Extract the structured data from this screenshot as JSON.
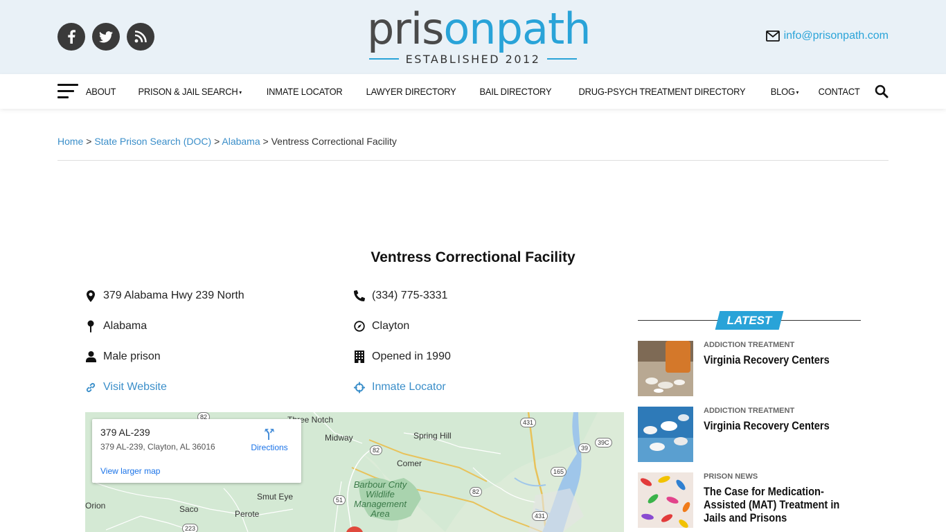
{
  "header": {
    "social": [
      "facebook-icon",
      "twitter-icon",
      "rss-icon"
    ],
    "logo": {
      "part1": "pris",
      "part2": "on",
      "part3": "path",
      "tagline": "ESTABLISHED 2012"
    },
    "email": "info@prisonpath.com"
  },
  "nav": {
    "items": [
      {
        "label": "ABOUT",
        "has_dropdown": false
      },
      {
        "label": "PRISON & JAIL SEARCH",
        "has_dropdown": true
      },
      {
        "label": "INMATE LOCATOR",
        "has_dropdown": false
      },
      {
        "label": "LAWYER DIRECTORY",
        "has_dropdown": false
      },
      {
        "label": "BAIL DIRECTORY",
        "has_dropdown": false
      },
      {
        "label": "DRUG-PSYCH TREATMENT DIRECTORY",
        "has_dropdown": false
      },
      {
        "label": "BLOG",
        "has_dropdown": true
      },
      {
        "label": "CONTACT",
        "has_dropdown": false
      }
    ]
  },
  "breadcrumb": {
    "home": "Home",
    "sep": ">",
    "state_search": "State Prison Search (DOC)",
    "state": "Alabama",
    "current": "Ventress Correctional Facility"
  },
  "facility": {
    "title": "Ventress Correctional Facility",
    "address": "379 Alabama Hwy 239 North",
    "phone": "(334) 775-3331",
    "state": "Alabama",
    "city": "Clayton",
    "type": "Male prison",
    "opened": "Opened in 1990",
    "website_link": "Visit Website",
    "inmate_locator_link": "Inmate Locator"
  },
  "map": {
    "card_title": "379 AL-239",
    "card_address": "379 AL-239, Clayton, AL 36016",
    "directions": "Directions",
    "larger_map": "View larger map",
    "places": [
      "Three Notch",
      "Midway",
      "Spring Hill",
      "Comer",
      "Smut Eye",
      "Orion",
      "Saco",
      "Perote"
    ],
    "park": "Barbour Cnty Wildlife Management Area",
    "roads": [
      "82",
      "431",
      "39C",
      "39",
      "165",
      "51",
      "223"
    ]
  },
  "sidebar": {
    "latest_label": "LATEST",
    "posts": [
      {
        "category": "ADDICTION TREATMENT",
        "title": "Virginia Recovery Centers"
      },
      {
        "category": "ADDICTION TREATMENT",
        "title": "Virginia Recovery Centers"
      },
      {
        "category": "PRISON NEWS",
        "title": "The Case for Medication-Assisted (MAT) Treatment in Jails and Prisons"
      }
    ]
  },
  "colors": {
    "accent": "#29a3d8",
    "link": "#3a8ec9",
    "header_bg": "#e9f1f7",
    "dark": "#3a3a3a"
  }
}
